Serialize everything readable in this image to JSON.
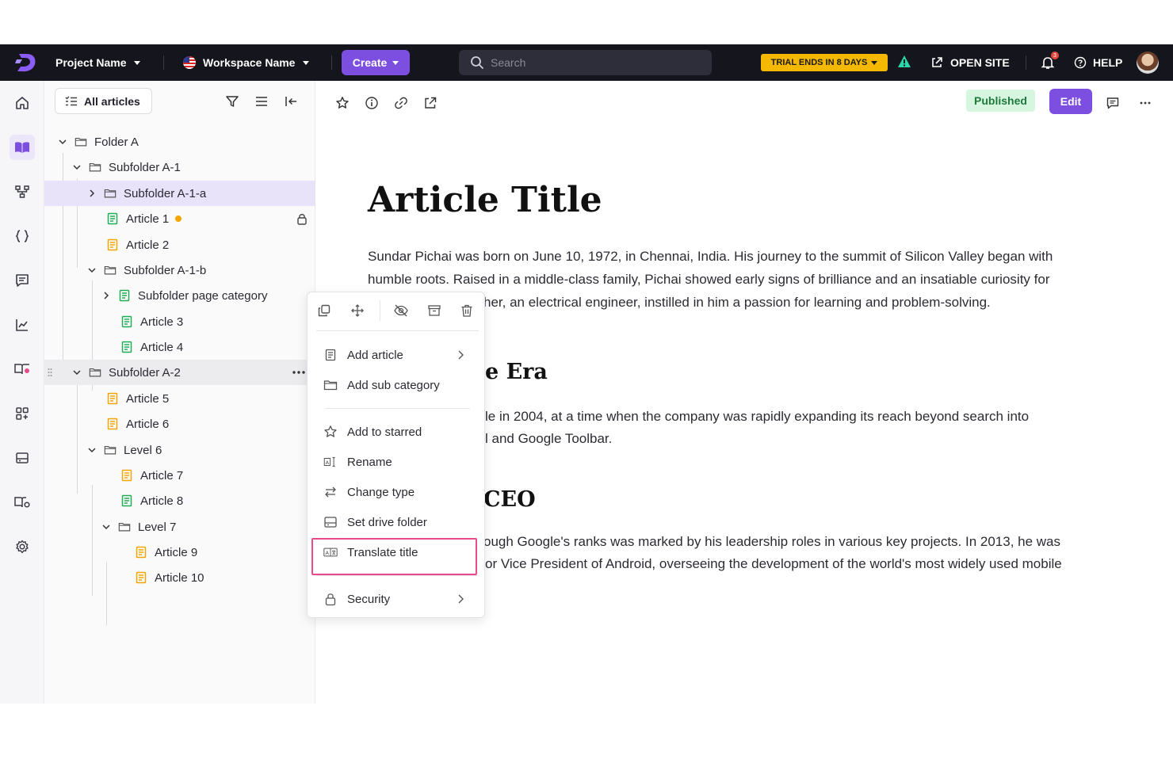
{
  "topbar": {
    "project_name": "Project Name",
    "workspace_name": "Workspace Name",
    "create_label": "Create",
    "search_placeholder": "Search",
    "trial_label": "TRIAL ENDS IN 8 DAYS",
    "open_site_label": "OPEN SITE",
    "notifications_count": "3",
    "help_label": "HELP"
  },
  "sidebar": {
    "filter_label": "All articles",
    "tree": [
      {
        "label": "Folder A",
        "type": "folder"
      },
      {
        "label": "Subfolder A-1",
        "type": "folder"
      },
      {
        "label": "Subfolder A-1-a",
        "type": "folder"
      },
      {
        "label": "Article 1",
        "type": "article"
      },
      {
        "label": "Article 2",
        "type": "article"
      },
      {
        "label": "Subfolder A-1-b",
        "type": "folder"
      },
      {
        "label": "Subfolder page category",
        "type": "article"
      },
      {
        "label": "Article 3",
        "type": "article"
      },
      {
        "label": "Article 4",
        "type": "article"
      },
      {
        "label": "Subfolder A-2",
        "type": "folder"
      },
      {
        "label": "Article 5",
        "type": "article"
      },
      {
        "label": "Article 6",
        "type": "article"
      },
      {
        "label": "Level 6",
        "type": "folder"
      },
      {
        "label": "Article 7",
        "type": "article"
      },
      {
        "label": "Article 8",
        "type": "article"
      },
      {
        "label": "Level 7",
        "type": "folder"
      },
      {
        "label": "Article 9",
        "type": "article"
      },
      {
        "label": "Article 10",
        "type": "article"
      }
    ]
  },
  "main": {
    "status_label": "Published",
    "edit_label": "Edit",
    "title": "Article Title",
    "p1_line1": "Sundar Pichai was born on June 10, 1972, in Chennai, India. His journey to the summit of Silicon Valley began with",
    "p1_line2": "humble roots. Raised in a middle-class family, Pichai showed early signs of brilliance and an insatiable curiosity for",
    "p1_line3": "her, an electrical engineer, instilled in him a passion for learning and problem-solving.",
    "h2_a": "e Era",
    "p2_line1": "le in 2004, at a time when the company was rapidly expanding its reach beyond search into",
    "p2_line2": "l and Google Toolbar.",
    "h2_b": "CEO",
    "p3_line1": "ough Google's ranks was marked by his leadership roles in various key projects. In 2013, he was",
    "p3_line2": "or Vice President of Android, overseeing the development of the world's most widely used mobile"
  },
  "context_menu": {
    "add_article": "Add article",
    "add_sub_category": "Add sub category",
    "add_to_starred": "Add to starred",
    "rename": "Rename",
    "change_type": "Change type",
    "set_drive_folder": "Set drive folder",
    "translate_title": "Translate title",
    "security": "Security"
  },
  "colors": {
    "accent": "#7c4fe0",
    "topbar_bg": "#15151d",
    "trial_bg": "#f5b800",
    "published_bg": "#d7f6df",
    "highlight": "#e84a8c",
    "article_green": "#1fae55",
    "article_orange": "#f5a500"
  }
}
